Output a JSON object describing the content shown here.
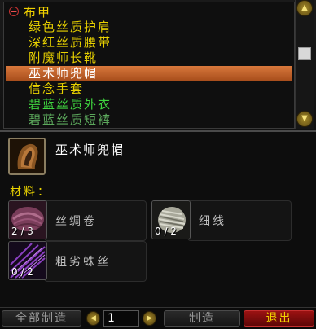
{
  "recipe_list": {
    "category": "布甲",
    "items": [
      {
        "label": "绿色丝质护肩",
        "color": "#e8d100"
      },
      {
        "label": "深红丝质腰带",
        "color": "#e8d100"
      },
      {
        "label": "附魔师长靴",
        "color": "#e8d100"
      },
      {
        "label": "巫术师兜帽",
        "color": "#ffffff",
        "selected": true
      },
      {
        "label": "信念手套",
        "color": "#e8d100"
      },
      {
        "label": "碧蓝丝质外衣",
        "color": "#3fd63f"
      },
      {
        "label": "碧蓝丝质短裤",
        "color": "#5ca85c"
      }
    ]
  },
  "detail": {
    "item_name": "巫术师兜帽",
    "materials_label": "材料：",
    "materials": [
      {
        "name": "丝绸卷",
        "count": "2 / 3",
        "icon": "silk-bolt-icon"
      },
      {
        "name": "细线",
        "count": "0 / 2",
        "icon": "fine-thread-icon"
      },
      {
        "name": "粗劣蛛丝",
        "count": "0 / 2",
        "icon": "spider-silk-icon"
      }
    ]
  },
  "bottom": {
    "create_all_label": "全部制造",
    "quantity": "1",
    "create_label": "制造",
    "exit_label": "退出"
  }
}
